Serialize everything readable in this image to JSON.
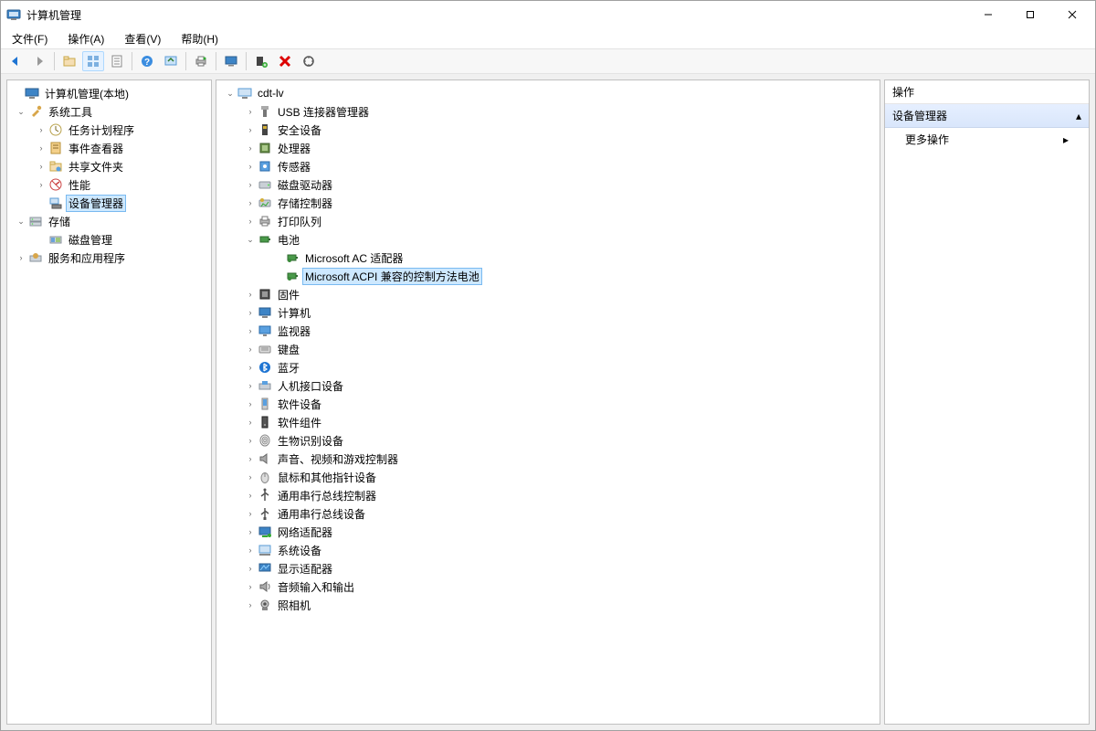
{
  "window": {
    "title": "计算机管理"
  },
  "menubar": [
    "文件(F)",
    "操作(A)",
    "查看(V)",
    "帮助(H)"
  ],
  "left_tree": {
    "root": "计算机管理(本地)",
    "system_tools": {
      "label": "系统工具",
      "children": [
        "任务计划程序",
        "事件查看器",
        "共享文件夹",
        "性能",
        "设备管理器"
      ]
    },
    "storage": {
      "label": "存储",
      "children": [
        "磁盘管理"
      ]
    },
    "services": {
      "label": "服务和应用程序"
    }
  },
  "center_tree": {
    "host": "cdt-lv",
    "categories": [
      {
        "label": "USB 连接器管理器",
        "icon": "usb"
      },
      {
        "label": "安全设备",
        "icon": "security"
      },
      {
        "label": "处理器",
        "icon": "cpu"
      },
      {
        "label": "传感器",
        "icon": "sensor"
      },
      {
        "label": "磁盘驱动器",
        "icon": "disk"
      },
      {
        "label": "存储控制器",
        "icon": "storage"
      },
      {
        "label": "打印队列",
        "icon": "printer"
      },
      {
        "label": "电池",
        "icon": "battery",
        "expanded": true,
        "children": [
          {
            "label": "Microsoft AC 适配器",
            "selected": false
          },
          {
            "label": "Microsoft ACPI 兼容的控制方法电池",
            "selected": true
          }
        ]
      },
      {
        "label": "固件",
        "icon": "firmware"
      },
      {
        "label": "计算机",
        "icon": "computer"
      },
      {
        "label": "监视器",
        "icon": "monitor"
      },
      {
        "label": "键盘",
        "icon": "keyboard"
      },
      {
        "label": "蓝牙",
        "icon": "bluetooth"
      },
      {
        "label": "人机接口设备",
        "icon": "hid"
      },
      {
        "label": "软件设备",
        "icon": "softdev"
      },
      {
        "label": "软件组件",
        "icon": "softcomp"
      },
      {
        "label": "生物识别设备",
        "icon": "biometric"
      },
      {
        "label": "声音、视频和游戏控制器",
        "icon": "sound"
      },
      {
        "label": "鼠标和其他指针设备",
        "icon": "mouse"
      },
      {
        "label": "通用串行总线控制器",
        "icon": "usbctrl"
      },
      {
        "label": "通用串行总线设备",
        "icon": "usbdev"
      },
      {
        "label": "网络适配器",
        "icon": "network"
      },
      {
        "label": "系统设备",
        "icon": "sysdev"
      },
      {
        "label": "显示适配器",
        "icon": "display"
      },
      {
        "label": "音频输入和输出",
        "icon": "audio"
      },
      {
        "label": "照相机",
        "icon": "camera"
      }
    ]
  },
  "right_panel": {
    "header": "操作",
    "section": "设备管理器",
    "more_actions": "更多操作"
  }
}
